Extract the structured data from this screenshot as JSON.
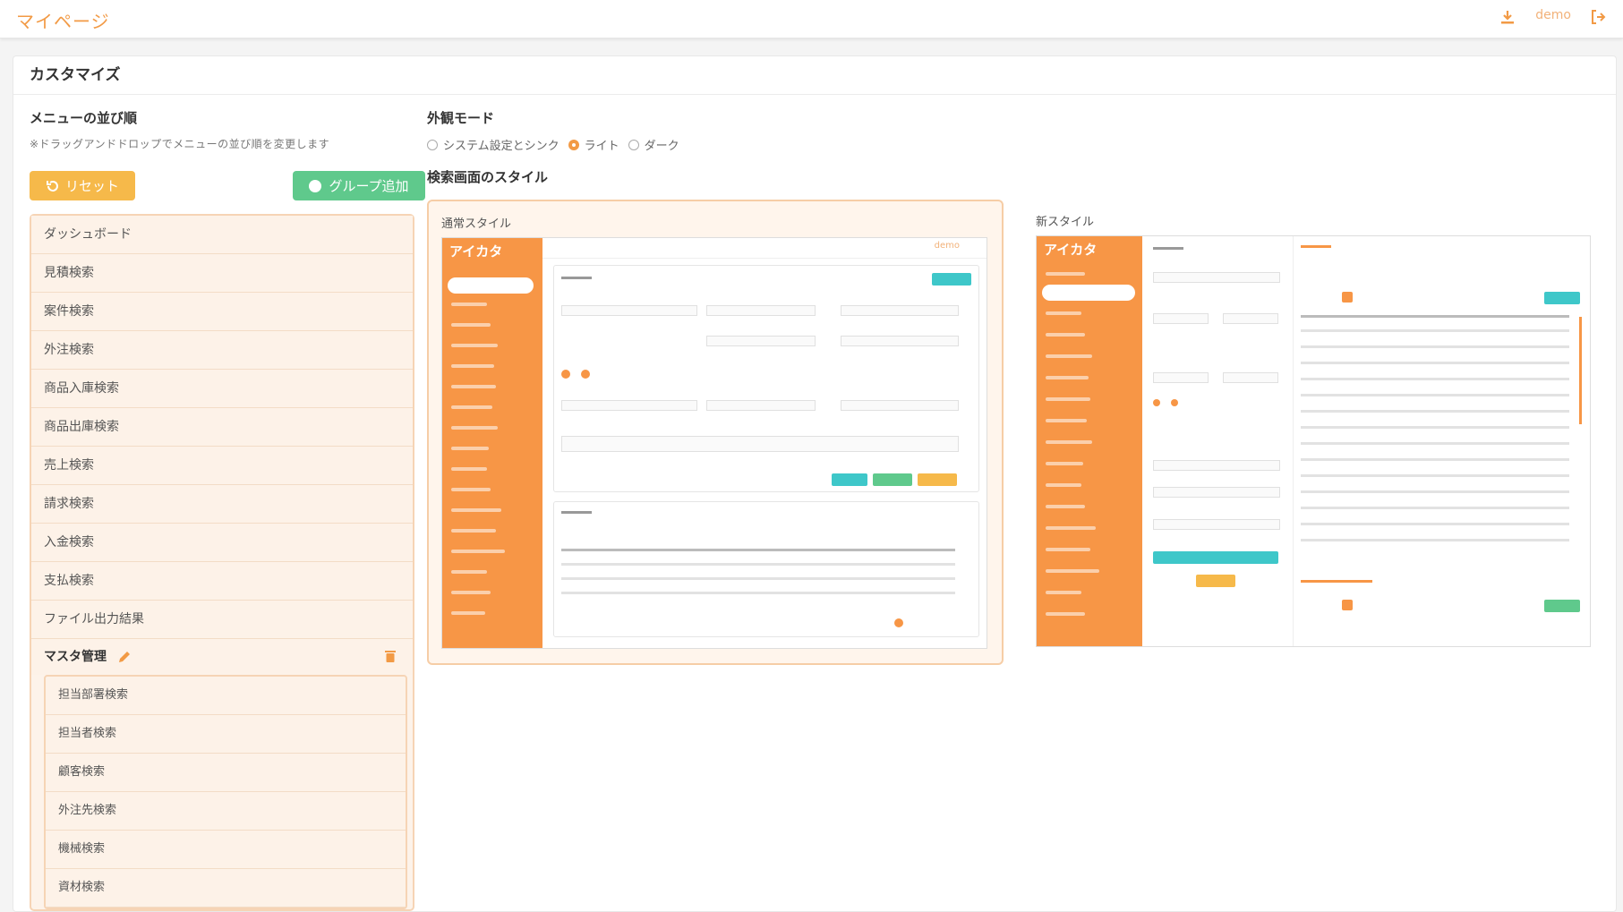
{
  "header": {
    "title": "マイページ",
    "user": "demo"
  },
  "card": {
    "title": "カスタマイズ"
  },
  "menu_order": {
    "title": "メニューの並び順",
    "note": "※ドラッグアンドドロップでメニューの並び順を変更します",
    "reset_label": "リセット",
    "add_group_label": "グループ追加",
    "items": [
      "ダッシュボード",
      "見積検索",
      "案件検索",
      "外注検索",
      "商品入庫検索",
      "商品出庫検索",
      "売上検索",
      "請求検索",
      "入金検索",
      "支払検索",
      "ファイル出力結果"
    ],
    "group": {
      "name": "マスタ管理",
      "items": [
        "担当部署検索",
        "担当者検索",
        "顧客検索",
        "外注先検索",
        "機械検索",
        "資材検索"
      ]
    }
  },
  "appearance": {
    "title": "外観モード",
    "options": [
      "システム設定とシンク",
      "ライト",
      "ダーク"
    ],
    "selected": "ライト"
  },
  "search_style": {
    "title": "検索画面のスタイル",
    "normal_label": "通常スタイル",
    "new_label": "新スタイル",
    "preview_logo": "アイカタ",
    "preview_user": "demo"
  },
  "colors": {
    "accent": "#f29a45",
    "sidebar": "#f79646",
    "reset": "#f6b94a",
    "group": "#5fc98c",
    "teal": "#3ec7c9"
  }
}
